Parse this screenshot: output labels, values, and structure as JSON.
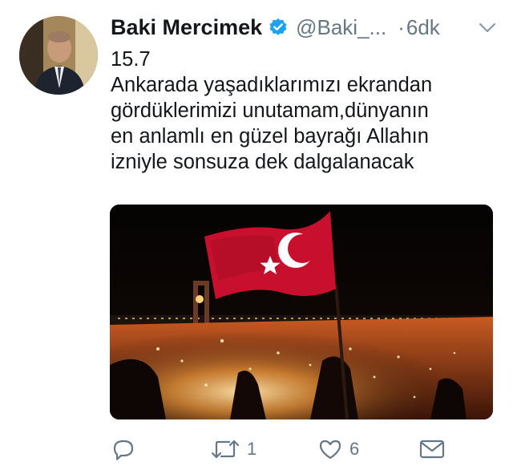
{
  "tweet": {
    "author_name": "Baki Mercimek",
    "handle": "@Baki_...",
    "separator": "·",
    "time": "6dk",
    "text_lines": [
      "15.7",
      "Ankarada yaşadıklarımızı ekrandan",
      "gördüklerimizi unutamam,dünyanın",
      "en anlamlı en güzel bayrağı Allahın",
      "izniyle sonsuza dek dalgalanacak"
    ]
  },
  "actions": {
    "reply_icon": "reply-icon",
    "retweet_icon": "retweet-icon",
    "retweet_count": "1",
    "like_icon": "heart-icon",
    "like_count": "6",
    "dm_icon": "envelope-icon"
  },
  "colors": {
    "text": "#14171a",
    "muted": "#657786",
    "verified": "#1da1f2",
    "flag_red": "#c8102e"
  }
}
